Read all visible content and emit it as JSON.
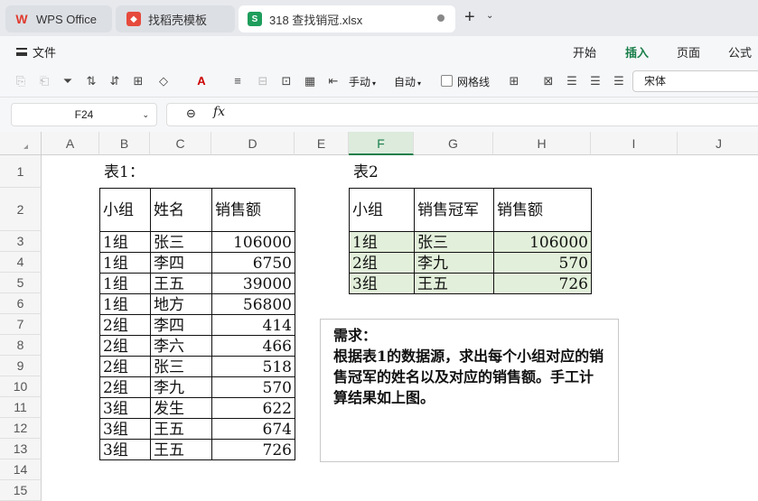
{
  "tabs": [
    {
      "label": "WPS Office"
    },
    {
      "label": "找稻壳模板"
    },
    {
      "label": "318 查找销冠.xlsx"
    }
  ],
  "menu": {
    "file_label": "文件",
    "items": [
      "开始",
      "插入",
      "页面",
      "公式"
    ],
    "active": "插入"
  },
  "toolbar": {
    "manual_label": "手动",
    "auto_label": "自动",
    "gridlines_label": "网格线",
    "font_name": "宋体"
  },
  "formula_bar": {
    "name_box": "F24",
    "fx_label": "fx",
    "formula": ""
  },
  "columns": [
    "A",
    "B",
    "C",
    "D",
    "E",
    "F",
    "G",
    "H",
    "I",
    "J"
  ],
  "selected_column": "F",
  "rows": [
    "1",
    "2",
    "3",
    "4",
    "5",
    "6",
    "7",
    "8",
    "9",
    "10",
    "11",
    "12",
    "13",
    "14",
    "15"
  ],
  "table1": {
    "caption": "表1：",
    "headers": [
      "小组",
      "姓名",
      "销售额"
    ],
    "rows": [
      [
        "1组",
        "张三",
        "106000"
      ],
      [
        "1组",
        "李四",
        "6750"
      ],
      [
        "1组",
        "王五",
        "39000"
      ],
      [
        "1组",
        "地方",
        "56800"
      ],
      [
        "2组",
        "李四",
        "414"
      ],
      [
        "2组",
        "李六",
        "466"
      ],
      [
        "2组",
        "张三",
        "518"
      ],
      [
        "2组",
        "李九",
        "570"
      ],
      [
        "3组",
        "发生",
        "622"
      ],
      [
        "3组",
        "王五",
        "674"
      ],
      [
        "3组",
        "王五",
        "726"
      ]
    ]
  },
  "table2": {
    "caption": "表2",
    "headers": [
      "小组",
      "销售冠军",
      "销售额"
    ],
    "rows": [
      [
        "1组",
        "张三",
        "106000"
      ],
      [
        "2组",
        "李九",
        "570"
      ],
      [
        "3组",
        "王五",
        "726"
      ]
    ],
    "fill_color": "#e2efda"
  },
  "note": {
    "title": "需求：",
    "body": "根据表1的数据源，求出每个小组对应的销售冠军的姓名以及对应的销售额。手工计算结果如上图。"
  }
}
